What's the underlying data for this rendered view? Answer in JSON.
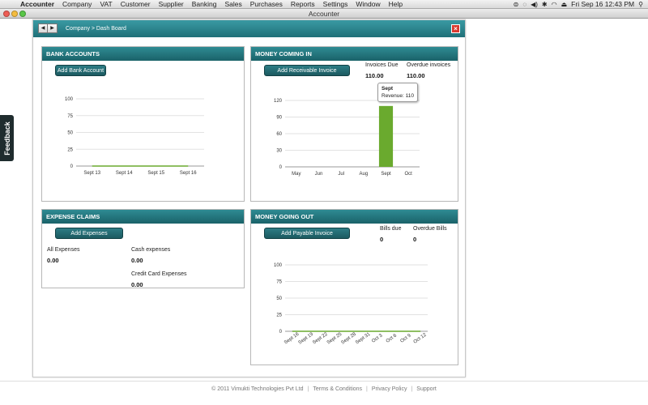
{
  "menubar": {
    "apple_icon": "apple-icon",
    "items": [
      "Accounter",
      "Company",
      "VAT",
      "Customer",
      "Supplier",
      "Banking",
      "Sales",
      "Purchases",
      "Reports",
      "Settings",
      "Window",
      "Help"
    ],
    "datetime": "Fri Sep 16  12:43 PM"
  },
  "window": {
    "title": "Accounter"
  },
  "feedback": {
    "label": "Feedback"
  },
  "app": {
    "breadcrumb": "Company > Dash Board",
    "back_icon": "◀",
    "forward_icon": "▶",
    "close_icon": "×"
  },
  "bank_accounts": {
    "title": "BANK ACCOUNTS",
    "add_button": "Add Bank Account"
  },
  "money_in": {
    "title": "MONEY COMING IN",
    "add_button": "Add Receivable Invoice",
    "invoices_due_label": "Invoices Due",
    "invoices_due_value": "110.00",
    "overdue_label": "Overdue invoices",
    "overdue_value": "110.00",
    "tooltip_title": "Sept",
    "tooltip_text": "Revenue: 110"
  },
  "expense_claims": {
    "title": "EXPENSE CLAIMS",
    "add_button": "Add Expenses",
    "all_label": "All Expenses",
    "all_value": "0.00",
    "cash_label": "Cash expenses",
    "cash_value": "0.00",
    "card_label": "Credit Card Expenses",
    "card_value": "0.00"
  },
  "money_out": {
    "title": "MONEY GOING OUT",
    "add_button": "Add Payable Invoice",
    "bills_due_label": "Bills due",
    "bills_due_value": "0",
    "overdue_label": "Overdue Bills",
    "overdue_value": "0"
  },
  "footer": {
    "copyright": "© 2011 Vimukti Technologies Pvt Ltd",
    "terms": "Terms & Conditions",
    "privacy": "Privacy Policy",
    "support": "Support"
  },
  "chart_data": [
    {
      "type": "line",
      "categories": [
        "Sept 13",
        "Sept 14",
        "Sept 15",
        "Sept 16"
      ],
      "values": [
        0,
        0,
        0,
        0
      ],
      "yticks": [
        0,
        25,
        50,
        75,
        100
      ],
      "ylim": [
        0,
        100
      ],
      "color": "#6aaa2e"
    },
    {
      "type": "bar",
      "categories": [
        "May",
        "Jun",
        "Jul",
        "Aug",
        "Sept",
        "Oct"
      ],
      "values": [
        0,
        0,
        0,
        0,
        110,
        0
      ],
      "yticks": [
        0,
        30,
        60,
        90,
        120
      ],
      "ylim": [
        0,
        120
      ],
      "color": "#6aaa2e"
    },
    {
      "type": "line",
      "categories": [
        "Sept 16",
        "Sept 19",
        "Sept 22",
        "Sept 25",
        "Sept 28",
        "Sept 31",
        "Oct 3",
        "Oct 6",
        "Oct 9",
        "Oct 12"
      ],
      "values": [
        0,
        0,
        0,
        0,
        0,
        0,
        0,
        0,
        0,
        0
      ],
      "yticks": [
        0,
        25,
        50,
        75,
        100
      ],
      "ylim": [
        0,
        100
      ],
      "color": "#6aaa2e"
    }
  ]
}
